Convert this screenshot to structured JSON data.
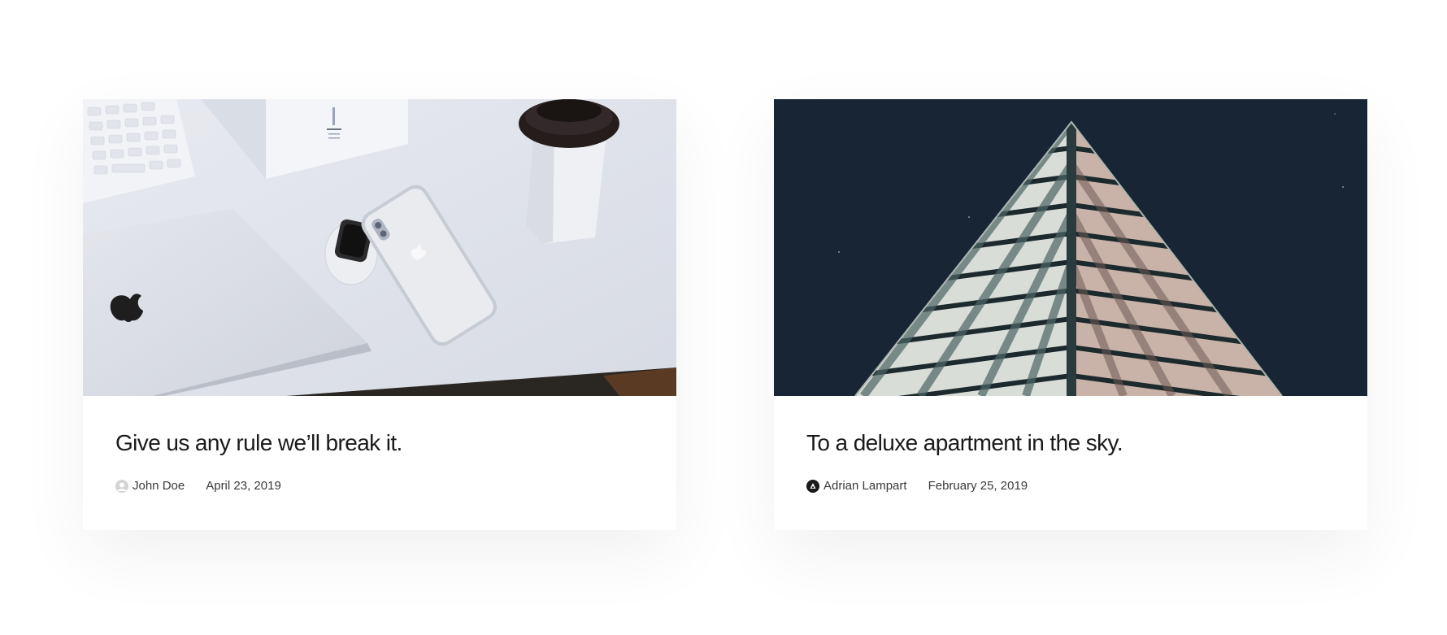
{
  "posts": [
    {
      "title": "Give us any rule we’ll break it.",
      "author": "John Doe",
      "date": "April 23, 2019",
      "avatar_icon": "user-silhouette-icon",
      "image_subject": "desk-devices-photo"
    },
    {
      "title": "To a deluxe apartment in the sky.",
      "author": "Adrian Lampart",
      "date": "February 25, 2019",
      "avatar_icon": "logo-a-icon",
      "image_subject": "building-triangle-photo"
    }
  ],
  "colors": {
    "title_text": "#1a1a1a",
    "meta_text": "#3a3a3a",
    "night_sky": "#172535",
    "desk": "#dfe2ea"
  }
}
